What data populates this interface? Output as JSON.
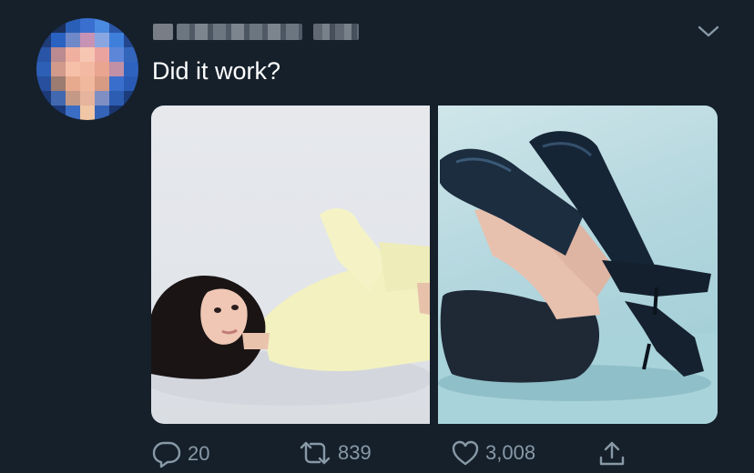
{
  "tweet": {
    "text": "Did it work?",
    "author_name_visible": "",
    "reply_count": "20",
    "retweet_count": "839",
    "like_count": "3,008"
  },
  "icons": {
    "menu": "chevron-down-icon",
    "reply": "reply-icon",
    "retweet": "retweet-icon",
    "like": "heart-icon",
    "share": "share-icon"
  },
  "colors": {
    "background": "#15202b",
    "text": "#ffffff",
    "muted": "#8899a6"
  }
}
